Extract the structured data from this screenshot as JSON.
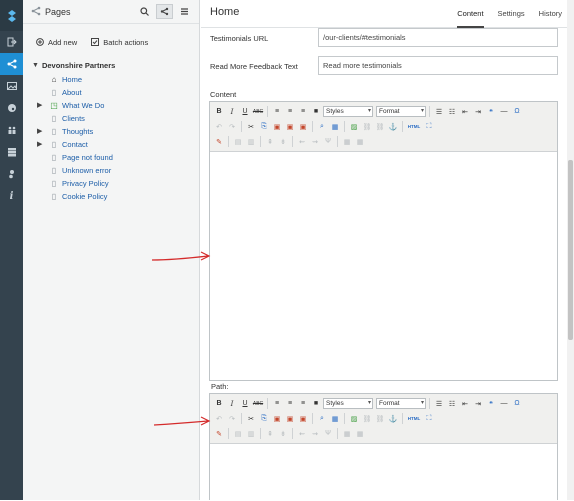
{
  "rail": {
    "items": [
      {
        "icon": "logout-icon"
      },
      {
        "icon": "sitetree-icon",
        "active": true
      },
      {
        "icon": "image-icon"
      },
      {
        "icon": "palette-icon"
      },
      {
        "icon": "users-icon"
      },
      {
        "icon": "database-icon"
      },
      {
        "icon": "settings-icon"
      },
      {
        "icon": "info-icon"
      }
    ]
  },
  "tree": {
    "title": "Pages",
    "add_new": "Add new",
    "batch_actions": "Batch actions",
    "root": "Devonshire Partners",
    "nodes": [
      "Home",
      "About",
      "What We Do",
      "Clients",
      "Thoughts",
      "Contact",
      "Page not found",
      "Unknown error",
      "Privacy Policy",
      "Cookie Policy"
    ]
  },
  "main": {
    "title": "Home",
    "tabs": [
      "Content",
      "Settings",
      "History"
    ],
    "fields": {
      "testimonials_url_label": "Testimonials URL",
      "testimonials_url_value": "/our-clients/#testimonials",
      "read_more_label": "Read More Feedback Text",
      "read_more_value": "Read more testimonials",
      "content_label": "Content",
      "path_label": "Path:"
    },
    "toolbar": {
      "styles": "Styles",
      "format": "Format",
      "html": "HTML"
    }
  }
}
